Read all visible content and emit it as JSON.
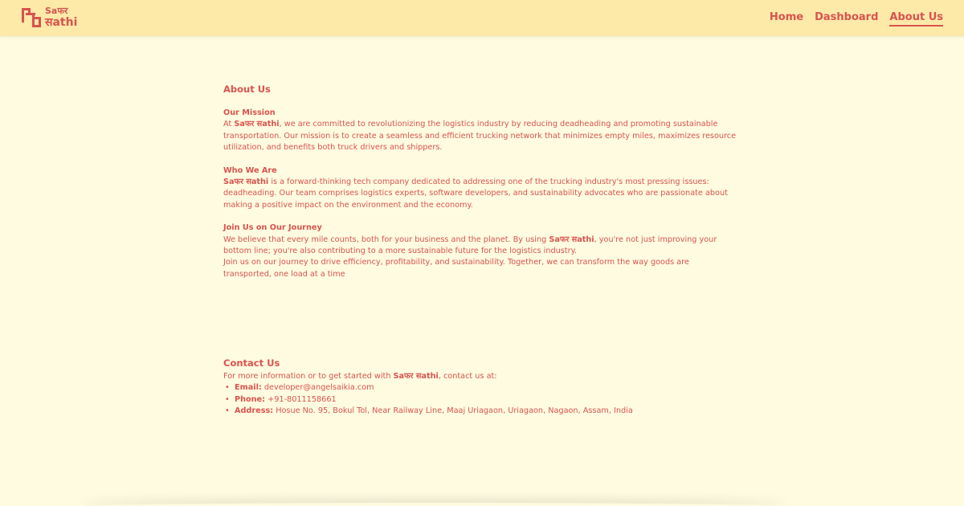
{
  "brand": {
    "logo_line1": "Saफर",
    "logo_line2": "सathi",
    "name": "Saफर सathi",
    "primary_color": "#d9534f",
    "nav_bg": "#fde9a8",
    "page_bg": "#fefbe0"
  },
  "nav": {
    "home": "Home",
    "dashboard": "Dashboard",
    "about": "About Us",
    "active": "About Us"
  },
  "about": {
    "title": "About Us",
    "mission": {
      "heading": "Our Mission",
      "prefix": "At ",
      "brand": "Saफर सathi",
      "text": ", we are committed to revolutionizing the logistics industry by reducing deadheading and promoting sustainable transportation. Our mission is to create a seamless and efficient trucking network that minimizes empty miles, maximizes resource utilization, and benefits both truck drivers and shippers."
    },
    "who": {
      "heading": "Who We Are",
      "brand": "Saफर सathi",
      "text": " is a forward-thinking tech company dedicated to addressing one of the trucking industry's most pressing issues: deadheading. Our team comprises logistics experts, software developers, and sustainability advocates who are passionate about making a positive impact on the environment and the economy."
    },
    "join": {
      "heading": "Join Us on Our Journey",
      "prefix": "We believe that every mile counts, both for your business and the planet. By using ",
      "brand": "Saफर सathi",
      "text": ", you're not just improving your bottom line; you're also contributing to a more sustainable future for the logistics industry.",
      "closing": "Join us on our journey to drive efficiency, profitability, and sustainability. Together, we can transform the way goods are transported, one load at a time"
    }
  },
  "contact": {
    "title": "Contact Us",
    "intro_prefix": "For more information or to get started with ",
    "brand": "Saफर सathi",
    "intro_suffix": ", contact us at:",
    "email_label": "Email:",
    "email": "developer@angelsaikia.com",
    "phone_label": "Phone:",
    "phone": "+91-8011158661",
    "address_label": "Address:",
    "address": "Hosue No. 95, Bokul Tol, Near Railway Line, Maaj Uriagaon, Uriagaon, Nagaon, Assam, India"
  }
}
